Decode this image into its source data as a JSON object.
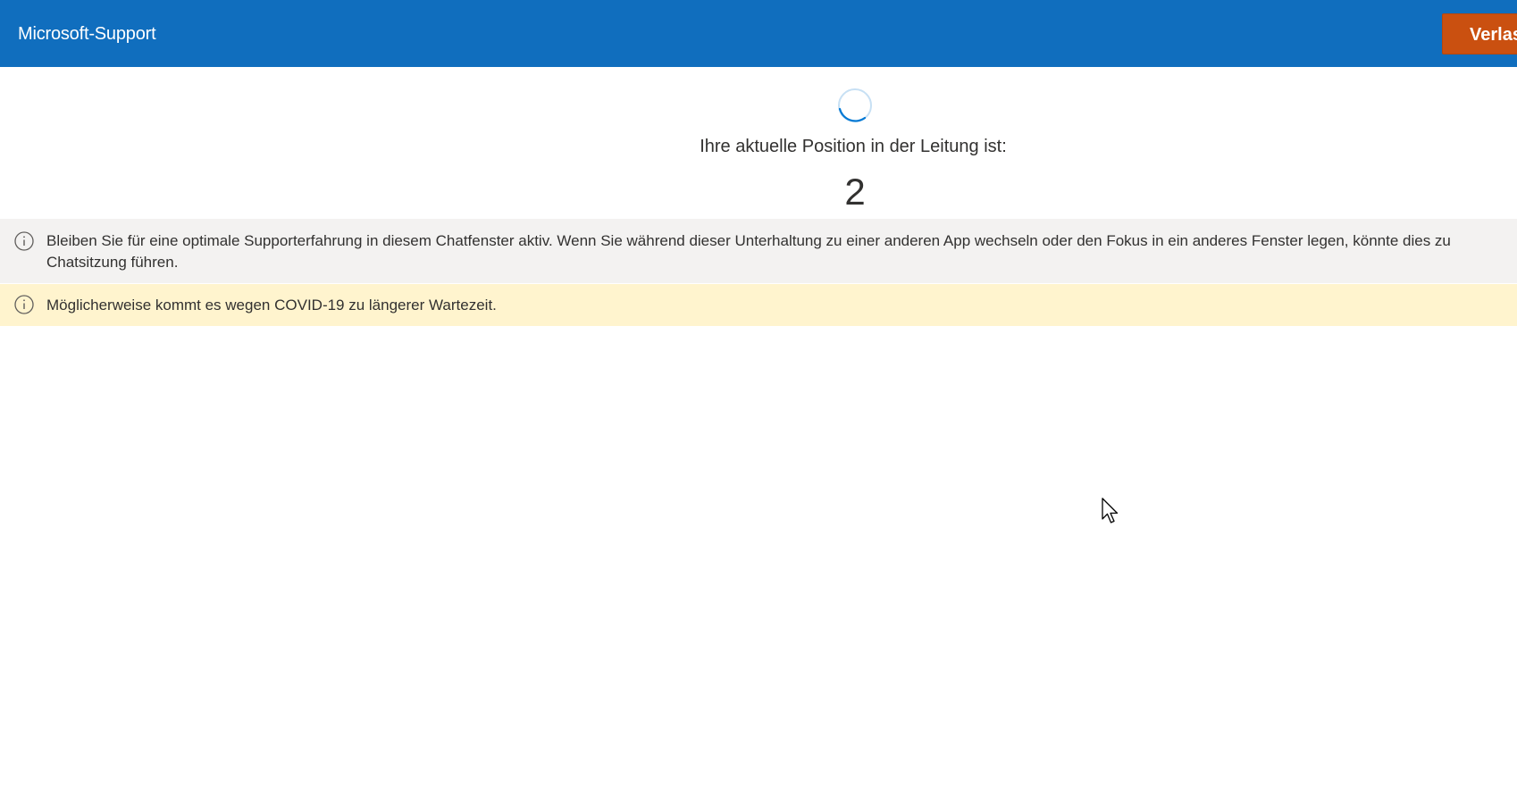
{
  "header": {
    "title": "Microsoft-Support",
    "leave_button_label": "Verlassen"
  },
  "queue": {
    "label": "Ihre aktuelle Position in der Leitung ist:",
    "position": "2"
  },
  "notices": {
    "focus_line1": "Bleiben Sie für eine optimale Supporterfahrung in diesem Chatfenster aktiv. Wenn Sie während dieser Unterhaltung zu einer anderen App wechseln oder den Fokus in ein anderes Fenster legen, könnte dies zu",
    "focus_line2": "Chatsitzung führen.",
    "covid": "Möglicherweise kommt es wegen COVID-19 zu längerer Wartezeit."
  },
  "colors": {
    "header": "#106ebe",
    "leave_button": "#ca5010",
    "notice_gray": "#f3f2f1",
    "notice_yellow": "#fff4ce",
    "spinner": "#0078d4"
  },
  "icons": {
    "info": "info-circle-icon",
    "spinner": "loading-spinner-icon",
    "cursor": "mouse-pointer-icon"
  }
}
